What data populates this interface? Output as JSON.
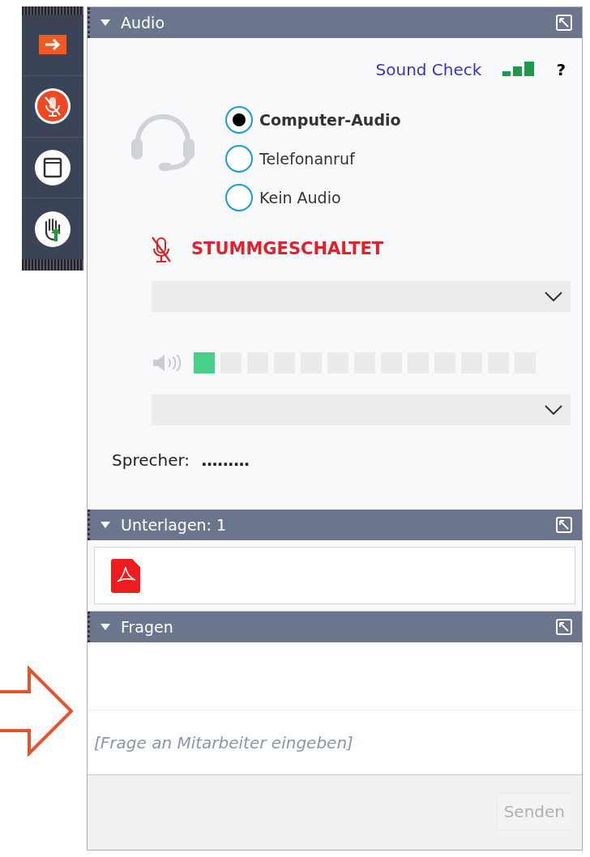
{
  "sidebar": {
    "buttons": [
      {
        "kind": "exit"
      },
      {
        "kind": "mic-muted"
      },
      {
        "kind": "window"
      },
      {
        "kind": "raise-hand"
      }
    ]
  },
  "audio": {
    "title": "Audio",
    "expanded": true,
    "sound_check": "Sound Check",
    "help": "?",
    "options": [
      {
        "label": "Computer-Audio",
        "selected": true
      },
      {
        "label": "Telefonanruf",
        "selected": false
      },
      {
        "label": "Kein Audio",
        "selected": false
      }
    ],
    "mute_status": "STUMMGESCHALTET",
    "speaker_meter": {
      "level": 0.077
    },
    "speaker_label": "Sprecher:",
    "speaker_value": "........."
  },
  "documents": {
    "title": "Unterlagen: 1",
    "expanded": true,
    "files": [
      {
        "kind": "pdf"
      }
    ]
  },
  "questions": {
    "title": "Fragen",
    "expanded": true,
    "placeholder": "[Frage an Mitarbeiter eingeben]",
    "send_button": {
      "label": "Senden",
      "disabled": true
    }
  }
}
